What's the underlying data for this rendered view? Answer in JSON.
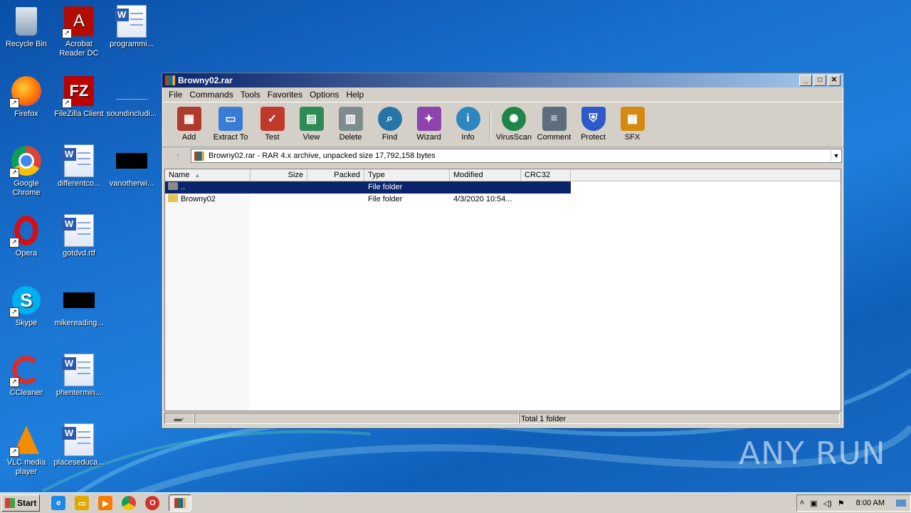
{
  "desktop": {
    "icons": [
      {
        "label": "Recycle Bin",
        "icon": "recycle-bin-icon"
      },
      {
        "label": "Acrobat Reader DC",
        "icon": "acrobat-icon"
      },
      {
        "label": "programmi...",
        "icon": "word-doc-icon"
      },
      {
        "label": "Firefox",
        "icon": "firefox-icon"
      },
      {
        "label": "FileZilla Client",
        "icon": "filezilla-icon"
      },
      {
        "label": "soundincludi...",
        "icon": "blank-file-icon"
      },
      {
        "label": "Google Chrome",
        "icon": "chrome-icon"
      },
      {
        "label": "differentco...",
        "icon": "word-doc-icon"
      },
      {
        "label": "vanotherwi...",
        "icon": "black-file-icon"
      },
      {
        "label": "Opera",
        "icon": "opera-icon"
      },
      {
        "label": "gotdvd.rtf",
        "icon": "word-doc-icon"
      },
      {
        "label": "Skype",
        "icon": "skype-icon"
      },
      {
        "label": "mikereading...",
        "icon": "black-file-icon"
      },
      {
        "label": "CCleaner",
        "icon": "ccleaner-icon"
      },
      {
        "label": "phentermin...",
        "icon": "word-doc-icon"
      },
      {
        "label": "VLC media player",
        "icon": "vlc-icon"
      },
      {
        "label": "placeseduca...",
        "icon": "word-doc-icon"
      }
    ],
    "watermark": "ANY RUN"
  },
  "window": {
    "title": "Browny02.rar",
    "controls": {
      "minimize": "_",
      "maximize": "□",
      "close": "✕"
    },
    "menu": [
      "File",
      "Commands",
      "Tools",
      "Favorites",
      "Options",
      "Help"
    ],
    "toolbar": [
      {
        "label": "Add",
        "icon": "add-archive-icon",
        "color": "#b03a2e"
      },
      {
        "label": "Extract To",
        "icon": "extract-folder-icon",
        "color": "#3a7bd5"
      },
      {
        "label": "Test",
        "icon": "test-checklist-icon",
        "color": "#c0392b"
      },
      {
        "label": "View",
        "icon": "view-book-icon",
        "color": "#2e8b57"
      },
      {
        "label": "Delete",
        "icon": "trash-icon",
        "color": "#7f8c8d"
      },
      {
        "label": "Find",
        "icon": "magnifier-icon",
        "color": "#2874a6"
      },
      {
        "label": "Wizard",
        "icon": "wand-icon",
        "color": "#8e44ad"
      },
      {
        "label": "Info",
        "icon": "info-icon",
        "color": "#2e86c1"
      },
      {
        "label": "VirusScan",
        "icon": "virus-scan-icon",
        "color": "#1e8449"
      },
      {
        "label": "Comment",
        "icon": "comment-icon",
        "color": "#5d6d7e"
      },
      {
        "label": "Protect",
        "icon": "shield-icon",
        "color": "#2c5ac8"
      },
      {
        "label": "SFX",
        "icon": "sfx-box-icon",
        "color": "#d68910"
      }
    ],
    "path": "Browny02.rar - RAR 4.x archive, unpacked size 17,792,158 bytes",
    "columns": [
      "Name",
      "Size",
      "Packed",
      "Type",
      "Modified",
      "CRC32"
    ],
    "rows": [
      {
        "name": "..",
        "size": "",
        "packed": "",
        "type": "File folder",
        "modified": "",
        "crc": "",
        "selected": true
      },
      {
        "name": "Browny02",
        "size": "",
        "packed": "",
        "type": "File folder",
        "modified": "4/3/2020 10:54...",
        "crc": "",
        "selected": false
      }
    ],
    "status": "Total 1 folder"
  },
  "taskbar": {
    "start": "Start",
    "clock": "8:00 AM",
    "pinned": [
      {
        "icon": "ie-icon",
        "color": "#1e88e5"
      },
      {
        "icon": "explorer-icon",
        "color": "#e0a800"
      },
      {
        "icon": "media-player-icon",
        "color": "#f57c00"
      },
      {
        "icon": "chrome-icon",
        "color": "#43a047"
      },
      {
        "icon": "opera-icon",
        "color": "#d32f2f"
      },
      {
        "icon": "winrar-icon",
        "color": "#7b1fa2"
      }
    ]
  }
}
